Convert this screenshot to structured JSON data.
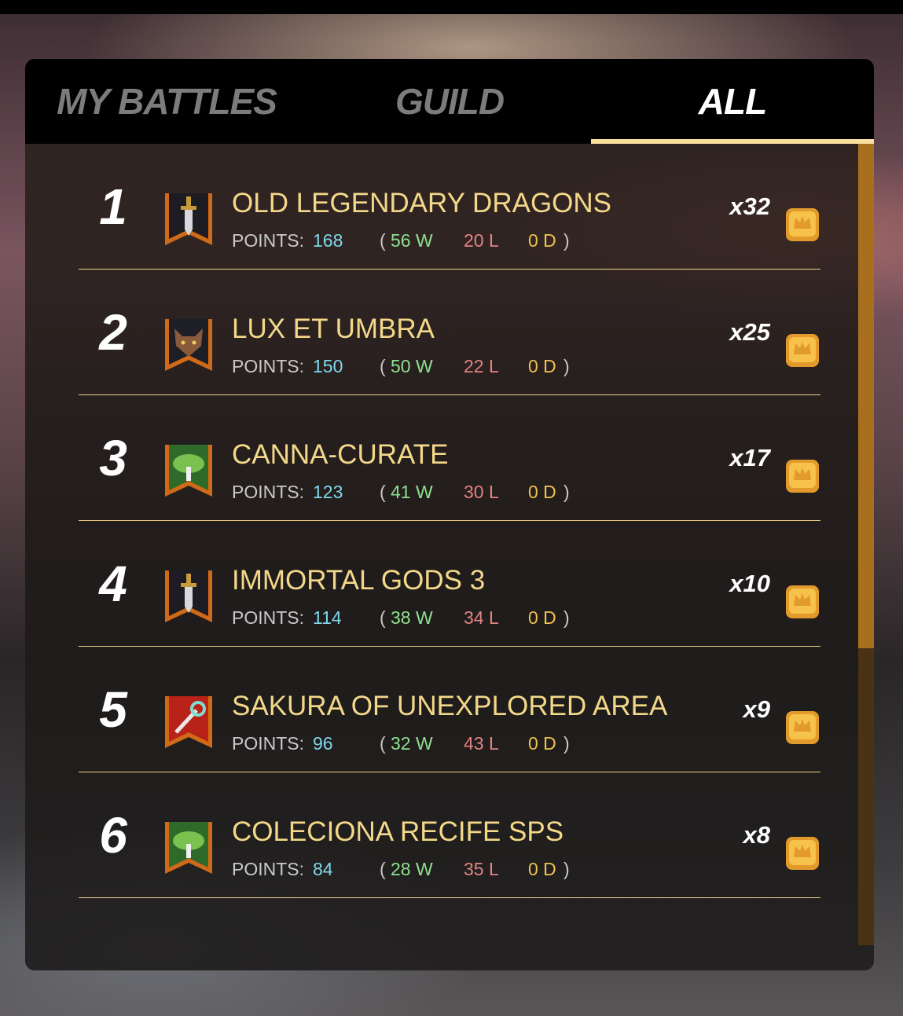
{
  "tabs": [
    {
      "label": "MY BATTLES",
      "active": false
    },
    {
      "label": "GUILD",
      "active": false
    },
    {
      "label": "ALL",
      "active": true
    }
  ],
  "colors": {
    "accent": "#f7dfa0",
    "name": "#f3d889",
    "points": "#7fd8e8",
    "wins": "#8fe08f",
    "losses": "#e38383",
    "draws": "#f1c24b",
    "divider": "#f2d388"
  },
  "rows": [
    {
      "rank": "1",
      "banner_icon": "sword-banner-icon",
      "name": "OLD LEGENDARY DRAGONS",
      "points_label": "POINTS:",
      "points": "168",
      "paren_open": "(",
      "wins": "56 W",
      "losses": "20 L",
      "draws": "0 D",
      "paren_close": ")",
      "multiplier": "x32",
      "reward_icon": "chest-icon"
    },
    {
      "rank": "2",
      "banner_icon": "wolf-banner-icon",
      "name": "LUX ET UMBRA",
      "points_label": "POINTS:",
      "points": "150",
      "paren_open": "(",
      "wins": "50 W",
      "losses": "22 L",
      "draws": "0 D",
      "paren_close": ")",
      "multiplier": "x25",
      "reward_icon": "chest-icon"
    },
    {
      "rank": "3",
      "banner_icon": "tree-banner-icon",
      "name": "CANNA-CURATE",
      "points_label": "POINTS:",
      "points": "123",
      "paren_open": "(",
      "wins": "41 W",
      "losses": "30 L",
      "draws": "0 D",
      "paren_close": ")",
      "multiplier": "x17",
      "reward_icon": "chest-icon"
    },
    {
      "rank": "4",
      "banner_icon": "sword-banner-icon",
      "name": "IMMORTAL GODS 3",
      "points_label": "POINTS:",
      "points": "114",
      "paren_open": "(",
      "wins": "38 W",
      "losses": "34 L",
      "draws": "0 D",
      "paren_close": ")",
      "multiplier": "x10",
      "reward_icon": "chest-icon"
    },
    {
      "rank": "5",
      "banner_icon": "staff-banner-icon",
      "name": "SAKURA OF UNEXPLORED AREA",
      "points_label": "POINTS:",
      "points": "96",
      "paren_open": "(",
      "wins": "32 W",
      "losses": "43 L",
      "draws": "0 D",
      "paren_close": ")",
      "multiplier": "x9",
      "reward_icon": "chest-icon"
    },
    {
      "rank": "6",
      "banner_icon": "tree-banner-icon",
      "name": "COLECIONA RECIFE SPS",
      "points_label": "POINTS:",
      "points": "84",
      "paren_open": "(",
      "wins": "28 W",
      "losses": "35 L",
      "draws": "0 D",
      "paren_close": ")",
      "multiplier": "x8",
      "reward_icon": "chest-icon"
    }
  ]
}
